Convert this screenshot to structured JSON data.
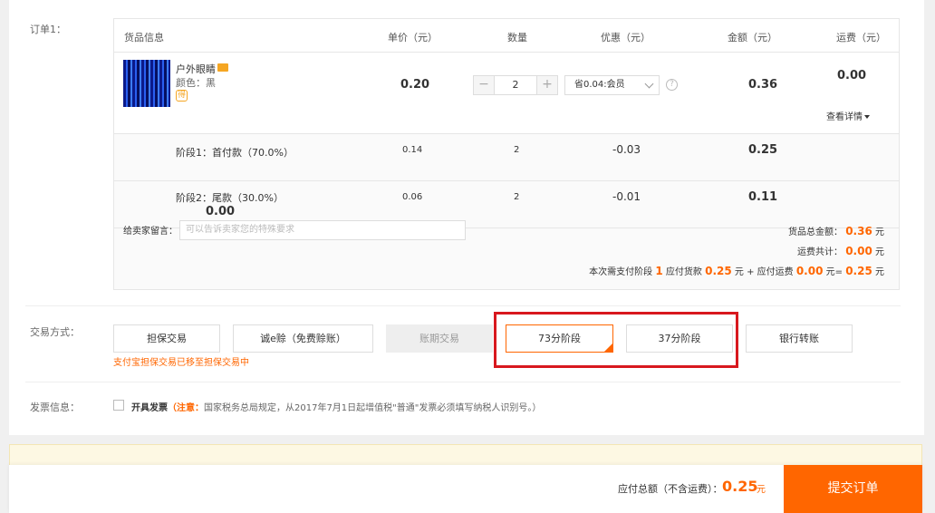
{
  "order": {
    "label": "订单1：",
    "headers": {
      "product": "货品信息",
      "unit_price": "单价（元）",
      "quantity": "数量",
      "discount": "优惠（元）",
      "amount": "金额（元）",
      "shipping": "运费（元）"
    },
    "item": {
      "name": "户外眼睛",
      "color": "颜色：黑",
      "badge": "得",
      "unit_price": "0.20",
      "quantity": "2",
      "discount_selected": "省0.04:会员",
      "amount": "0.36",
      "shipping": "0.00",
      "detail_link": "查看详情"
    },
    "stages": [
      {
        "label": "阶段1：首付款（70.0%）",
        "unit_price": "0.14",
        "quantity": "2",
        "discount": "-0.03",
        "amount": "0.25",
        "extra": ""
      },
      {
        "label": "阶段2：尾款（30.0%）",
        "unit_price": "0.06",
        "quantity": "2",
        "discount": "-0.01",
        "amount": "0.11",
        "extra": "0.00"
      }
    ],
    "message": {
      "label": "给卖家留言：",
      "placeholder": "可以告诉卖家您的特殊要求"
    },
    "summary": {
      "goods_total_label": "货品总金额：",
      "goods_total": "0.36",
      "shipping_total_label": "运费共计：",
      "shipping_total": "0.00",
      "unit": "元",
      "stage_prefix": "本次需支付阶段",
      "stage_no": "1",
      "stage_goods_label": "应付货款",
      "stage_goods": "0.25",
      "stage_ship_label": "元 + 应付运费",
      "stage_ship": "0.00",
      "stage_eq": "元=",
      "stage_total": "0.25",
      "stage_unit": "元"
    }
  },
  "payment": {
    "label": "交易方式：",
    "options": [
      "担保交易",
      "诚e赊（免费赊账）",
      "账期交易",
      "73分阶段",
      "37分阶段",
      "银行转账"
    ],
    "warning": "支付宝担保交易已移至担保交易中"
  },
  "invoice": {
    "label": "发票信息：",
    "checkbox_label": "开具发票",
    "note_label": "（注意：",
    "note": "国家税务总局规定，从2017年7月1日起增值税\"普通\"发票必须填写纳税人识别号。）"
  },
  "footer": {
    "total_label": "应付总额（不含运费）：",
    "total": "0.25",
    "unit": "元",
    "submit": "提交订单"
  },
  "colors": {
    "accent": "#ff6600",
    "highlight": "#d8181e"
  }
}
